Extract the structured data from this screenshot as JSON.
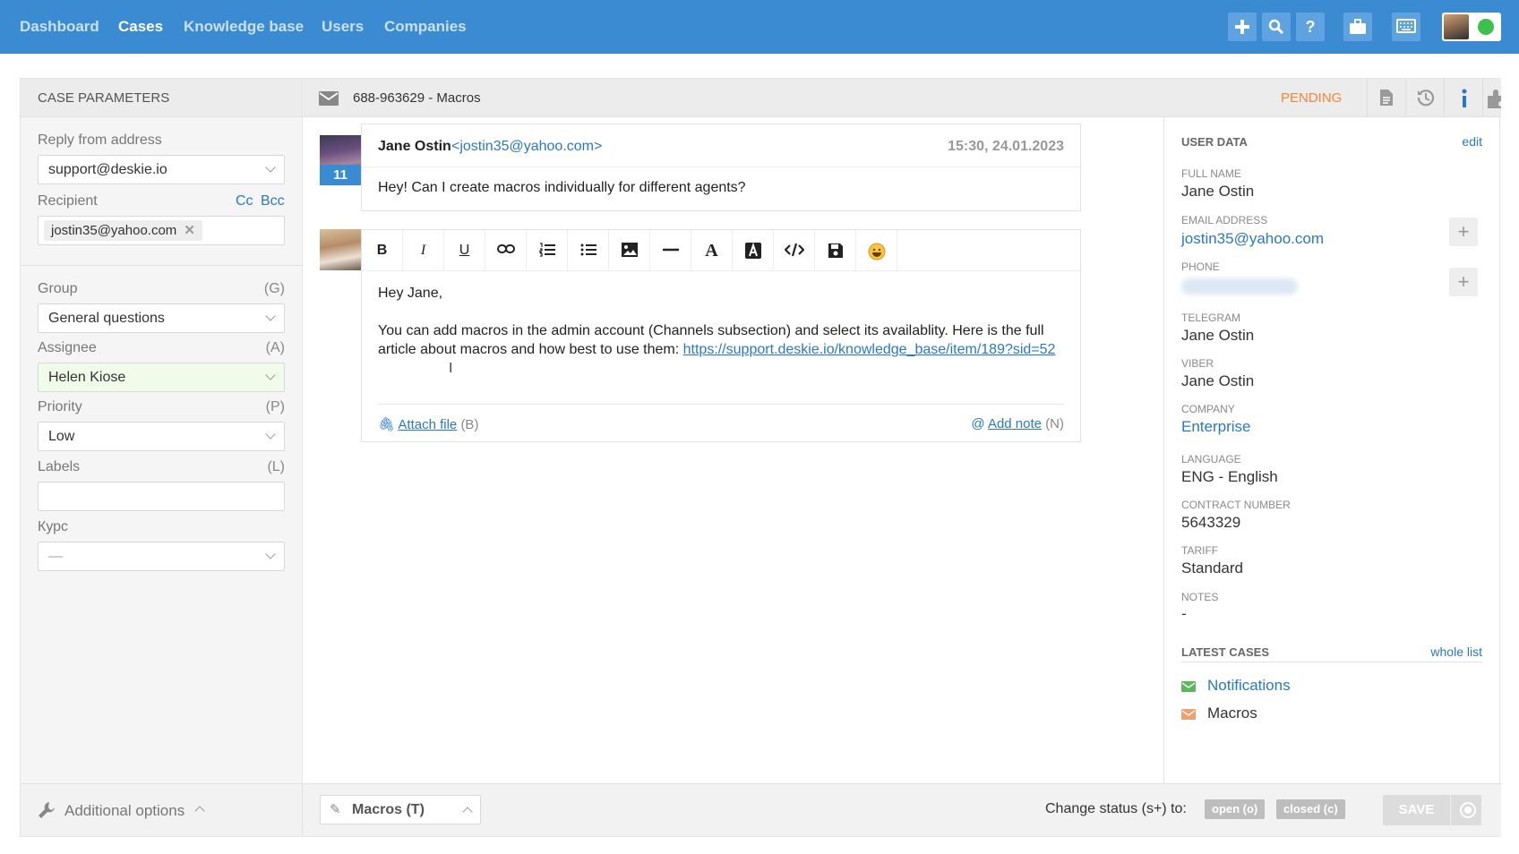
{
  "nav": {
    "dashboard": "Dashboard",
    "cases": "Cases",
    "knowledge_base": "Knowledge base",
    "users": "Users",
    "companies": "Companies"
  },
  "toolbar_icons": [
    "plus-icon",
    "search-icon",
    "help-icon",
    "briefcase-icon",
    "keyboard-icon"
  ],
  "colors": {
    "topbar": "#3b8bd3",
    "accent": "#2a78c8",
    "pending": "#f0883a",
    "online": "#3fc04d"
  },
  "left": {
    "title": "CASE PARAMETERS",
    "reply_from_label": "Reply from address",
    "reply_from_value": "support@deskie.io",
    "recipient_label": "Recipient",
    "cc": "Cc",
    "bcc": "Bcc",
    "recipient_chip": "jostin35@yahoo.com",
    "group_label": "Group",
    "group_key": "(G)",
    "group_value": "General questions",
    "assignee_label": "Assignee",
    "assignee_key": "(A)",
    "assignee_value": "Helen Kiose",
    "priority_label": "Priority",
    "priority_key": "(P)",
    "priority_value": "Low",
    "labels_label": "Labels",
    "labels_key": "(L)",
    "kurs_label": "Курс",
    "kurs_value": "—"
  },
  "header": {
    "case_title": "688-963629 - Macros",
    "status": "PENDING"
  },
  "message": {
    "sender_name": "Jane Ostin",
    "sender_email": "<jostin35@yahoo.com>",
    "time": "15:30, 24.01.2023",
    "badge": "11",
    "text": "Hey! Can I create macros individually for different agents?"
  },
  "reply": {
    "greeting": "Hey Jane,",
    "body": "You can add macros in the admin account (Channels subsection) and select its availablity. Here is the full article about macros and how best to use them: ",
    "link": "https://support.deskie.io/knowledge_base/item/189?sid=52",
    "attach": "Attach file",
    "attach_key": "(B)",
    "note": "Add note",
    "note_key": "(N)"
  },
  "user_data": {
    "title": "USER DATA",
    "edit": "edit",
    "full_name_label": "FULL NAME",
    "full_name": "Jane Ostin",
    "email_label": "EMAIL ADDRESS",
    "email": "jostin35@yahoo.com",
    "phone_label": "PHONE",
    "telegram_label": "TELEGRAM",
    "telegram": "Jane Ostin",
    "viber_label": "VIBER",
    "viber": "Jane Ostin",
    "company_label": "COMPANY",
    "company": "Enterprise",
    "language_label": "LANGUAGE",
    "language": "ENG - English",
    "contract_label": "CONTRACT NUMBER",
    "contract": "5643329",
    "tariff_label": "TARIFF",
    "tariff": "Standard",
    "notes_label": "NOTES",
    "notes": "-"
  },
  "latest_cases": {
    "title": "LATEST CASES",
    "whole_list": "whole list",
    "items": [
      "Notifications",
      "Macros"
    ]
  },
  "bottom": {
    "additional_options": "Additional options",
    "macros": "Macros (T)",
    "change_status": "Change status (s+) to:",
    "open": "open (o)",
    "closed": "closed (c)",
    "save": "SAVE"
  }
}
